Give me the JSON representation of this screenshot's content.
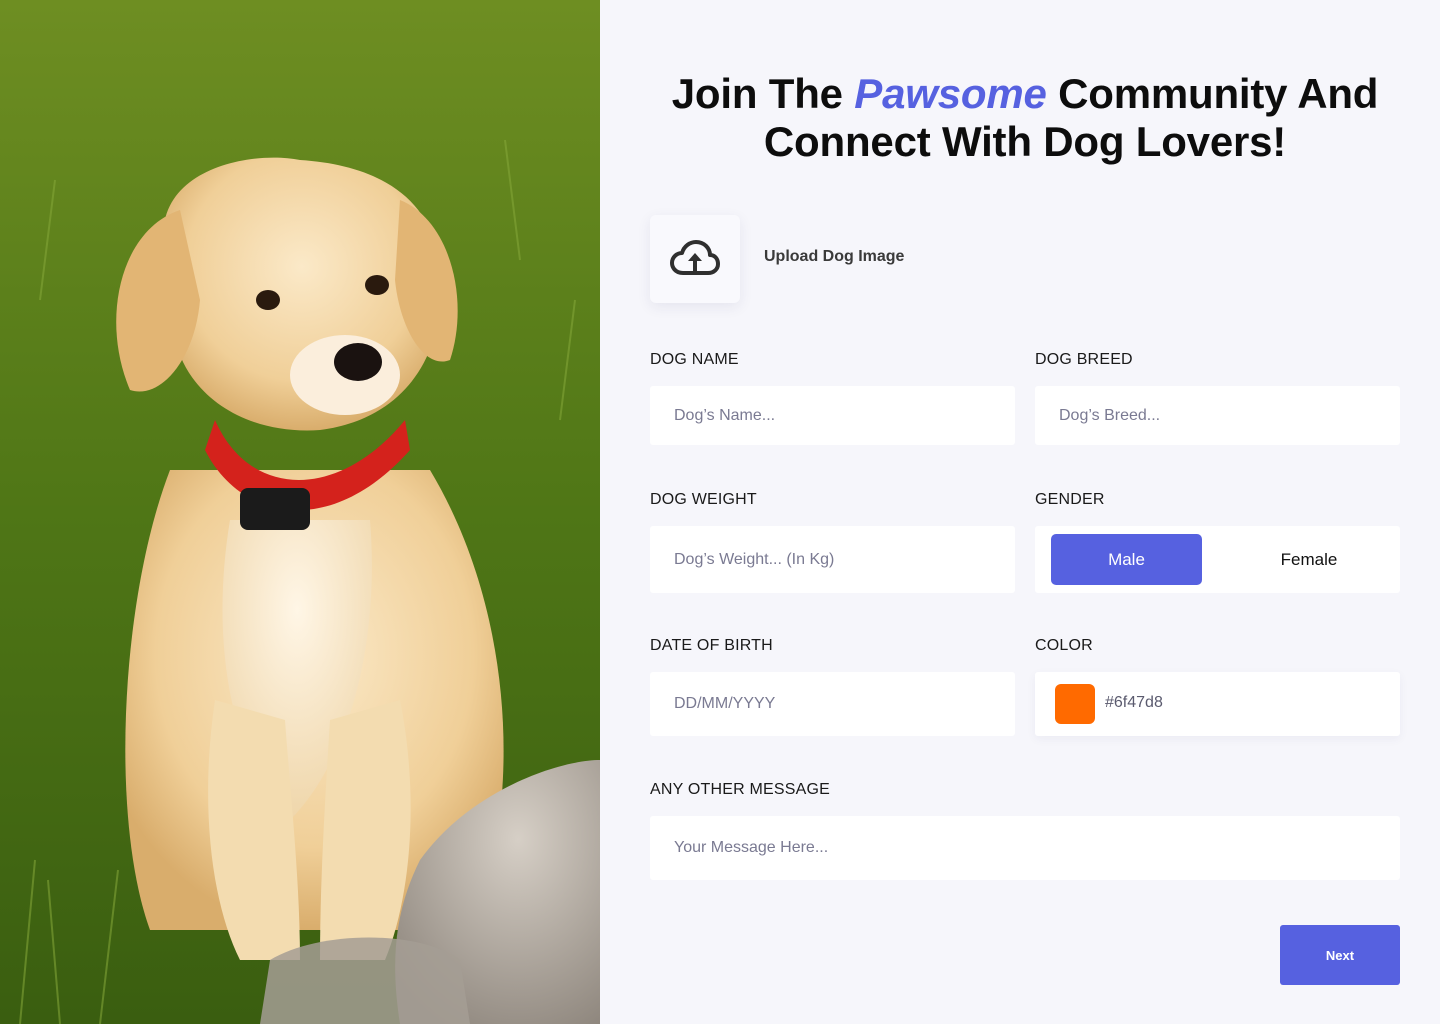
{
  "hero": {
    "image_alt": "Puppy sitting on grass"
  },
  "heading": {
    "before": "Join The ",
    "accent": "Pawsome",
    "after": " Community And Connect With Dog Lovers!"
  },
  "upload": {
    "label": "Upload Dog Image",
    "icon": "cloud-upload-icon"
  },
  "fields": {
    "dog_name": {
      "label": "DOG NAME",
      "placeholder": "Dog’s Name..."
    },
    "dog_breed": {
      "label": "DOG BREED",
      "placeholder": "Dog’s Breed..."
    },
    "dog_weight": {
      "label": "DOG WEIGHT",
      "placeholder": "Dog’s Weight... (In Kg)"
    },
    "gender": {
      "label": "GENDER",
      "options": [
        "Male",
        "Female"
      ],
      "selected": "Male"
    },
    "date_of_birth": {
      "label": "DATE OF BIRTH",
      "placeholder": "DD/MM/YYYY"
    },
    "color": {
      "label": "COLOR",
      "value": "#6f47d8",
      "swatch": "#ff6a00"
    },
    "message": {
      "label": "ANY OTHER MESSAGE",
      "placeholder": "Your Message Here..."
    }
  },
  "actions": {
    "next_label": "Next"
  },
  "colors": {
    "accent": "#5661e0",
    "background": "#f6f6fb",
    "field_bg": "#ffffff"
  }
}
